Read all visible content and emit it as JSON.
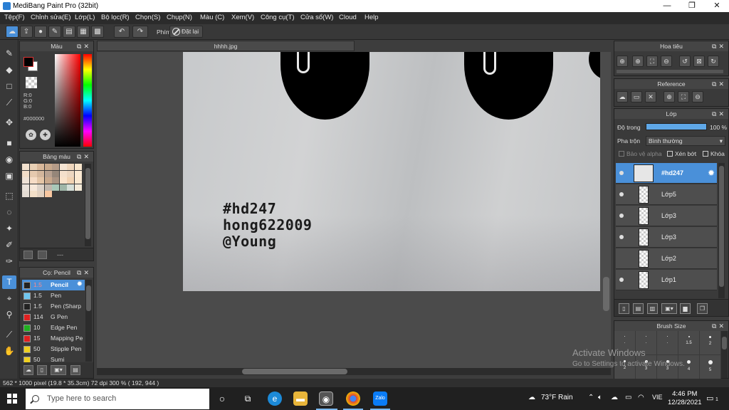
{
  "window": {
    "title": "MediBang Paint Pro (32bit)",
    "minimize": "—",
    "maximize": "❐",
    "close": "✕"
  },
  "menu": [
    "Tệp(F)",
    "Chỉnh sửa(E)",
    "Lớp(L)",
    "Bộ lọc(R)",
    "Chọn(S)",
    "Chụp(N)",
    "Màu (C)",
    "Xem(V)",
    "Công cụ(T)",
    "Cửa sổ(W)",
    "Cloud",
    "Help"
  ],
  "toolbar": {
    "keys_label": "Phím",
    "reset_label": "Đặt lại"
  },
  "color_panel": {
    "title": "Màu",
    "r": "R:0",
    "g": "G:0",
    "b": "B:0",
    "hex": "#000000"
  },
  "palette_panel": {
    "title": "Bảng màu",
    "footer_text": "---",
    "swatches": [
      "#f3e2cf",
      "#e9d0b5",
      "#d9b89a",
      "#c9a98c",
      "#b69c88",
      "#f6e5d3",
      "#f0d7bd",
      "#f9e6cc",
      "#f2ddc8",
      "#e6c9ae",
      "#d3b69c",
      "#b8a190",
      "#958679",
      "#f4e0cc",
      "#ecd6c0",
      "#fbe9d2",
      "#efe2d6",
      "#f6dcc6",
      "#e4c5a6",
      "#c8a88c",
      "#a99382",
      "#f9e3cb",
      "#f1d2b2",
      "#fae8d0",
      "#eae2da",
      "#f7e8da",
      "#ddd2c8",
      "#c1b7ad",
      "#a8c7b8",
      "#9fb6a8",
      "#d5dfd8",
      "#f4ead8",
      "#e5ddd4",
      "#f3dfc8",
      "#e2d1c0",
      "#f8c7a0"
    ]
  },
  "brush_panel": {
    "title": "Cọ: Pencil",
    "items": [
      {
        "size": "1.5",
        "name": "Pencil",
        "color": "#222222",
        "selected": true
      },
      {
        "size": "1.5",
        "name": "Pen",
        "color": "#6ec6f0"
      },
      {
        "size": "1.5",
        "name": "Pen (Sharp",
        "color": "#222222"
      },
      {
        "size": "114",
        "name": "G Pen",
        "color": "#e02020"
      },
      {
        "size": "10",
        "name": "Edge Pen",
        "color": "#20b020"
      },
      {
        "size": "15",
        "name": "Mapping Pe",
        "color": "#e02020"
      },
      {
        "size": "50",
        "name": "Stipple Pen",
        "color": "#f0d020"
      },
      {
        "size": "50",
        "name": "Sumi",
        "color": "#f0d020"
      }
    ]
  },
  "document": {
    "tab_name": "hhhh.jpg",
    "image_text": [
      "#hd247",
      "hong622009",
      "@Young"
    ]
  },
  "navigator_panel": {
    "title": "Hoa tiêu"
  },
  "reference_panel": {
    "title": "Reference"
  },
  "layer_panel": {
    "title": "Lớp",
    "opacity_label": "Độ trong",
    "opacity_value": "100 %",
    "opacity": 1.0,
    "blend_label": "Pha trộn",
    "blend_value": "Bình thường",
    "protect_alpha": "Bảo vệ alpha",
    "clipping": "Xén bớt",
    "lock": "Khóa",
    "layers": [
      {
        "name": "#hd247",
        "selected": true
      },
      {
        "name": "Lớp5"
      },
      {
        "name": "Lớp3"
      },
      {
        "name": "Lớp3"
      },
      {
        "name": "Lớp2"
      },
      {
        "name": "Lớp1"
      }
    ]
  },
  "brushsize_panel": {
    "title": "Brush Size",
    "cells": [
      {
        "label": "."
      },
      {
        "label": "."
      },
      {
        "label": "."
      },
      {
        "label": "1.5"
      },
      {
        "label": "2"
      },
      {
        "label": "2"
      },
      {
        "label": "3"
      },
      {
        "label": "3"
      },
      {
        "label": "4"
      },
      {
        "label": "5"
      }
    ]
  },
  "status": {
    "text": "562 * 1000 pixel  (19.8 * 35.3cm)  72 dpi  300 %  ( 192, 944 )"
  },
  "watermark": {
    "line1": "Activate Windows",
    "line2": "Go to Settings to activate Windows."
  },
  "taskbar": {
    "search_placeholder": "Type here to search",
    "weather": "73°F  Rain",
    "lang": "VIE",
    "time": "4:46 PM",
    "date": "12/28/2021",
    "notifications": "1"
  }
}
